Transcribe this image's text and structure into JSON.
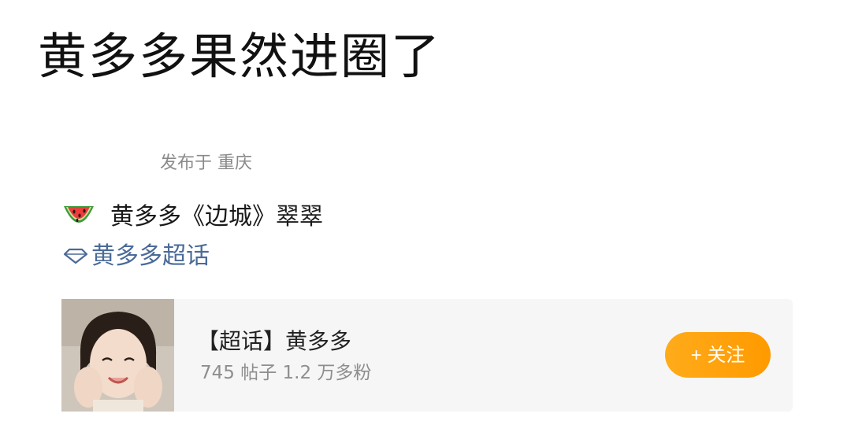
{
  "post": {
    "title": "黄多多果然进圈了",
    "location_meta": "发布于 重庆",
    "body_line": "黄多多《边城》翠翠",
    "topic_link": "黄多多超话"
  },
  "topic_card": {
    "title": "【超话】黄多多",
    "stats": "745 帖子 1.2 万多粉",
    "follow_label": "+ 关注"
  },
  "colors": {
    "follow_button": "#ff9f0a",
    "topic_link": "#4a6a98",
    "meta_text": "#8a8a8a",
    "card_background": "#f6f6f6"
  },
  "icons": {
    "emoji": "watermelon-icon",
    "topic": "diamond-icon"
  }
}
